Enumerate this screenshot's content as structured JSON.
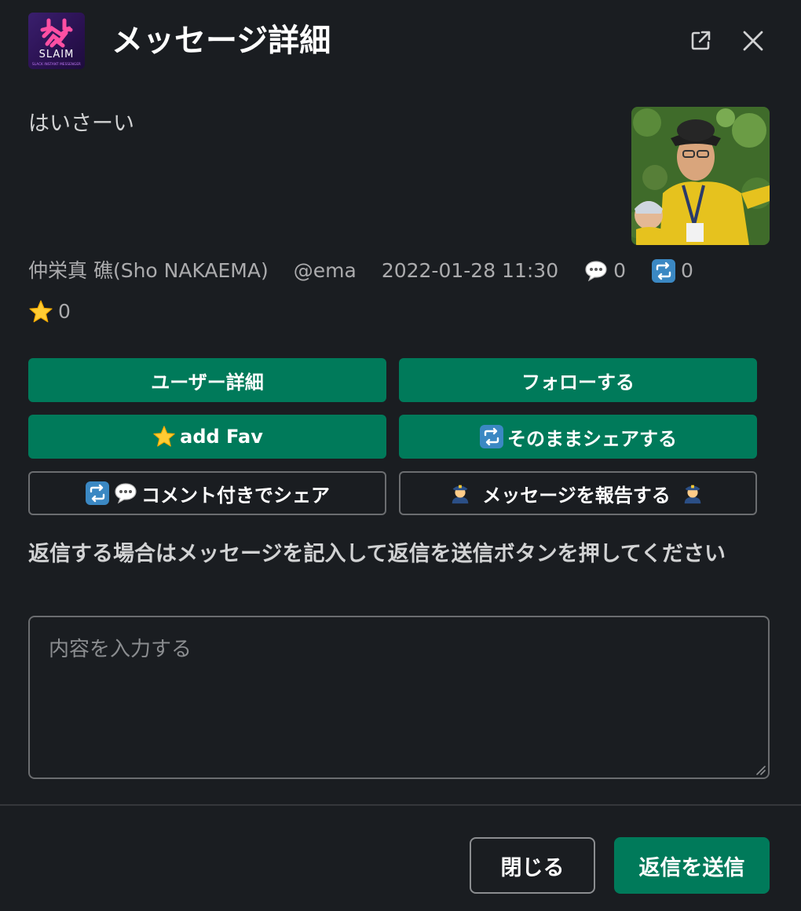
{
  "header": {
    "logo_text": "SLAIM",
    "logo_subtext": "SLACK INSTANT MESSENGER",
    "title": "メッセージ詳細",
    "open_external_icon": "external-link-icon",
    "close_icon": "close-icon"
  },
  "message": {
    "text": "はいさーい",
    "author_display_name": "仲栄真 礁(Sho NAKAEMA)",
    "author_handle": "@ema",
    "timestamp": "2022-01-28 11:30",
    "comment_count": "0",
    "share_count": "0",
    "fav_count": "0",
    "avatar_icon": "user-photo"
  },
  "actions": {
    "user_detail": "ユーザー詳細",
    "follow": "フォローする",
    "add_fav": "add Fav",
    "share_as_is": "そのままシェアする",
    "share_with_comment": "コメント付きでシェア",
    "report_message": "メッセージを報告する"
  },
  "reply": {
    "instructions": "返信する場合はメッセージを記入して返信を送信ボタンを押してください",
    "placeholder": "内容を入力する",
    "value": ""
  },
  "footer": {
    "close_label": "閉じる",
    "send_label": "返信を送信"
  },
  "colors": {
    "background": "#1a1d21",
    "primary_button": "#007a5a",
    "border": "#6b6d70",
    "muted_text": "#ababad"
  }
}
